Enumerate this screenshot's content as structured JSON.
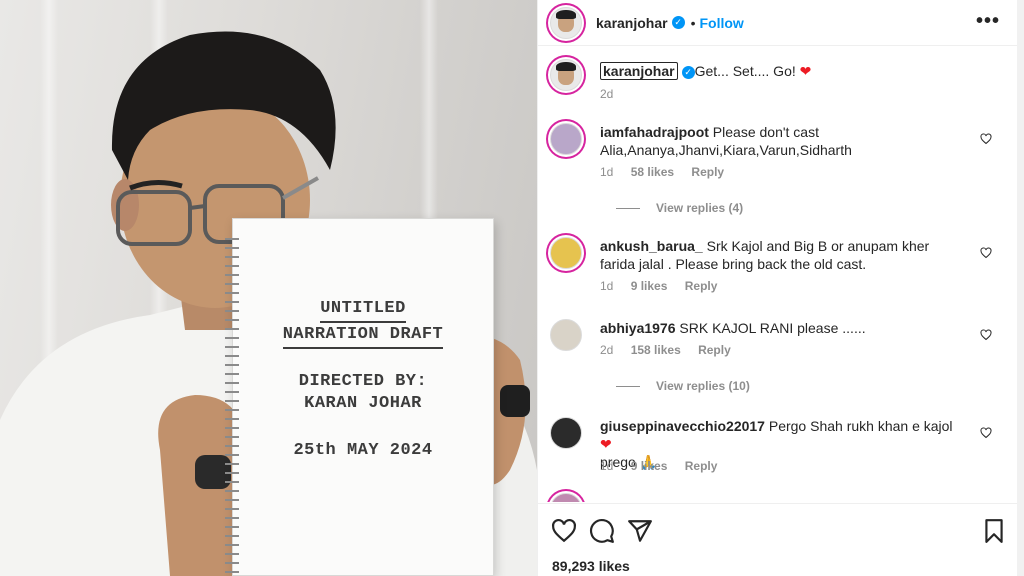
{
  "notebook": {
    "line1": "UNTITLED",
    "line2": "NARRATION DRAFT",
    "line3": "DIRECTED BY:",
    "line4": "KARAN JOHAR",
    "line5": "25th MAY 2024"
  },
  "header": {
    "username": "karanjohar",
    "follow_label": "Follow",
    "separator": "•",
    "more": "•••"
  },
  "caption": {
    "username": "karanjohar",
    "text": "Get... Set.... Go!",
    "emoji": "❤",
    "time": "2d"
  },
  "comments": [
    {
      "username": "iamfahadrajpoot",
      "text": "Please don't cast Alia,Ananya,Jhanvi,Kiara,Varun,Sidharth",
      "time": "1d",
      "likes": "58 likes",
      "reply": "Reply",
      "view_replies": "View replies (4)"
    },
    {
      "username": "ankush_barua_",
      "text": "Srk Kajol and Big B or anupam kher farida jalal . Please bring back the old cast.",
      "time": "1d",
      "likes": "9 likes",
      "reply": "Reply"
    },
    {
      "username": "abhiya1976",
      "text": "SRK KAJOL RANI please ......",
      "time": "2d",
      "likes": "158 likes",
      "reply": "Reply",
      "view_replies": "View replies (10)"
    },
    {
      "username": "giuseppinavecchio22017",
      "text": "Pergo Shah rukh khan e kajol",
      "emoji": "❤",
      "text2": "prego 🙏",
      "time": "1d",
      "likes": "9 likes",
      "reply": "Reply"
    }
  ],
  "footer": {
    "likes": "89,293 likes"
  },
  "colors": {
    "accent": "#0095f6",
    "heart": "#ed1c24",
    "muted": "#8e8e8e"
  },
  "icons": [
    "heart-icon",
    "comment-icon",
    "share-icon",
    "bookmark-icon",
    "more-icon",
    "verified-icon"
  ]
}
